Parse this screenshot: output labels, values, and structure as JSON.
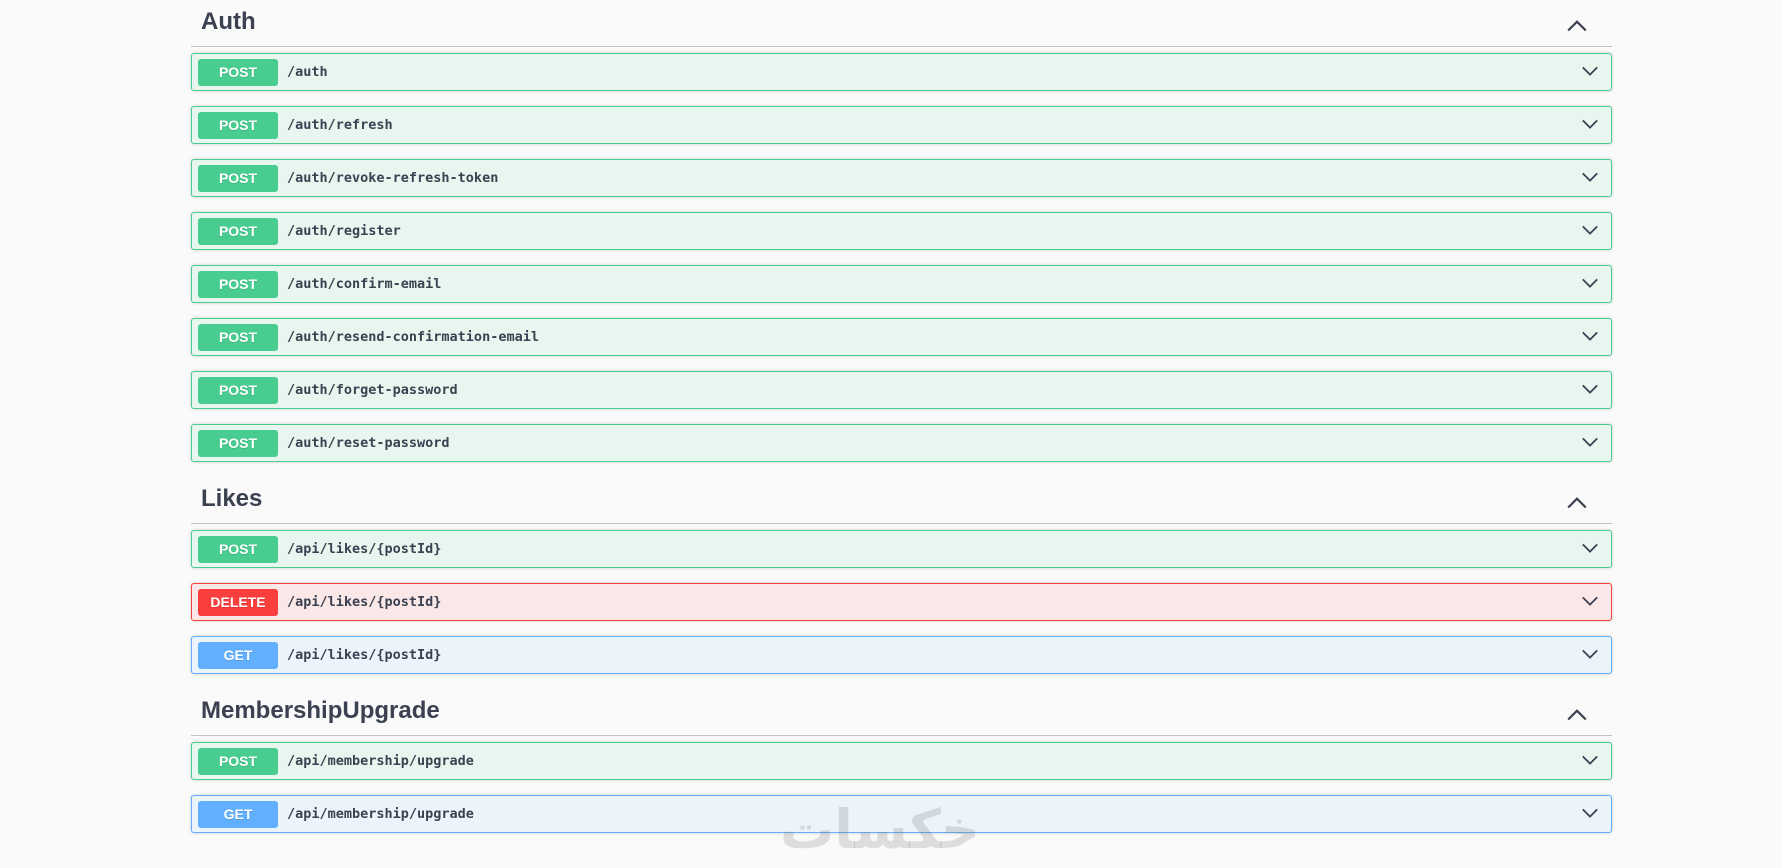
{
  "sections": [
    {
      "title": "Auth",
      "operations": [
        {
          "method": "POST",
          "path": "/auth"
        },
        {
          "method": "POST",
          "path": "/auth/refresh"
        },
        {
          "method": "POST",
          "path": "/auth/revoke-refresh-token"
        },
        {
          "method": "POST",
          "path": "/auth/register"
        },
        {
          "method": "POST",
          "path": "/auth/confirm-email"
        },
        {
          "method": "POST",
          "path": "/auth/resend-confirmation-email"
        },
        {
          "method": "POST",
          "path": "/auth/forget-password"
        },
        {
          "method": "POST",
          "path": "/auth/reset-password"
        }
      ]
    },
    {
      "title": "Likes",
      "operations": [
        {
          "method": "POST",
          "path": "/api/likes/{postId}"
        },
        {
          "method": "DELETE",
          "path": "/api/likes/{postId}"
        },
        {
          "method": "GET",
          "path": "/api/likes/{postId}"
        }
      ]
    },
    {
      "title": "MembershipUpgrade",
      "operations": [
        {
          "method": "POST",
          "path": "/api/membership/upgrade"
        },
        {
          "method": "GET",
          "path": "/api/membership/upgrade"
        }
      ]
    }
  ],
  "watermark": "خکسات",
  "colors": {
    "post": "#49cc90",
    "delete": "#f93e3e",
    "get": "#61affe",
    "text": "#3b4151"
  },
  "icons": {
    "section_toggle": "chevron-up-icon",
    "operation_expand": "chevron-down-icon"
  }
}
